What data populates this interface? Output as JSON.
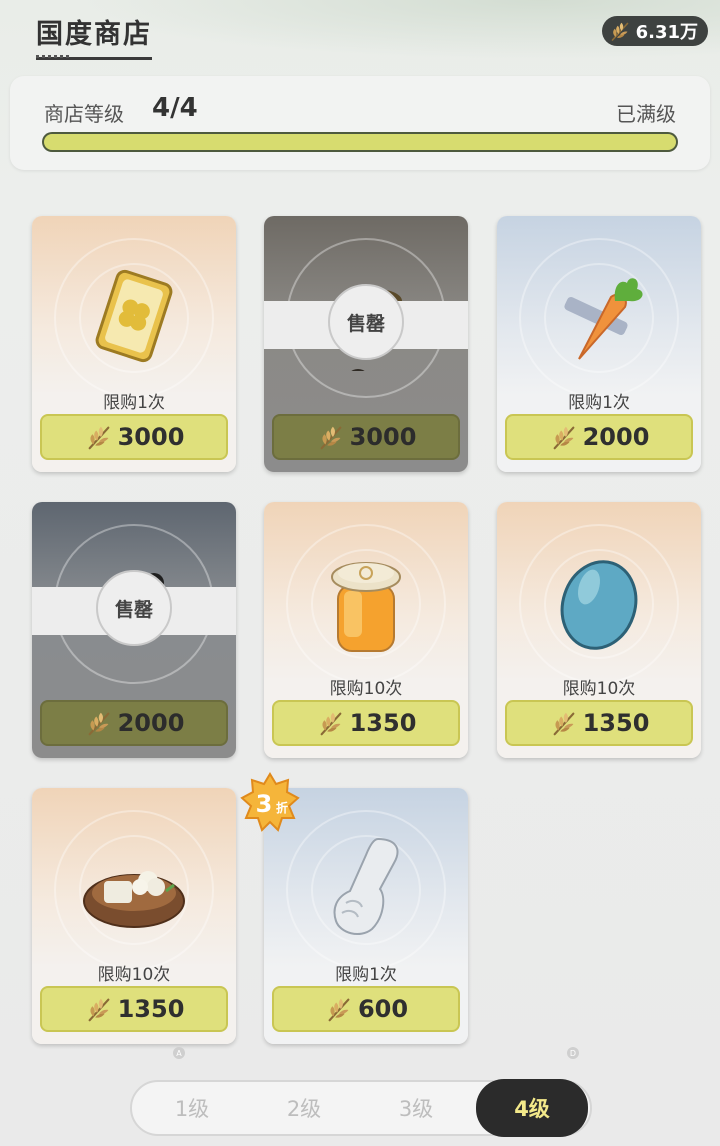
{
  "header": {
    "title": "国度商店",
    "currency_value": "6.31万",
    "currency_icon": "wheat-leaf-icon"
  },
  "level": {
    "label": "商店等级",
    "value": "4/4",
    "status": "已满级",
    "progress": 1.0
  },
  "items": [
    {
      "name": "clover-card",
      "limit": "限购1次",
      "price": "3000",
      "sold_out": false
    },
    {
      "name": "sold-out-item",
      "sold_label": "售罄",
      "price": "3000",
      "sold_out": true
    },
    {
      "name": "carrot",
      "limit": "限购1次",
      "price": "2000",
      "sold_out": false
    },
    {
      "name": "sold-out-item",
      "sold_label": "售罄",
      "price": "2000",
      "sold_out": true
    },
    {
      "name": "honey-jar",
      "limit": "限购10次",
      "price": "1350",
      "sold_out": false
    },
    {
      "name": "blue-egg",
      "limit": "限购10次",
      "price": "1350",
      "sold_out": false
    },
    {
      "name": "food-bowl",
      "limit": "限购10次",
      "price": "1350",
      "sold_out": false
    },
    {
      "name": "white-glove",
      "limit": "限购1次",
      "price": "600",
      "sold_out": false,
      "discount": "3折"
    }
  ],
  "tabs": [
    {
      "label": "1级",
      "active": false
    },
    {
      "label": "2级",
      "active": false
    },
    {
      "label": "3级",
      "active": false
    },
    {
      "label": "4级",
      "active": true
    }
  ],
  "colors": {
    "price_bg": "#dfe07c",
    "progress": "#d7dc6f",
    "tab_active": "#2b2b2b"
  }
}
